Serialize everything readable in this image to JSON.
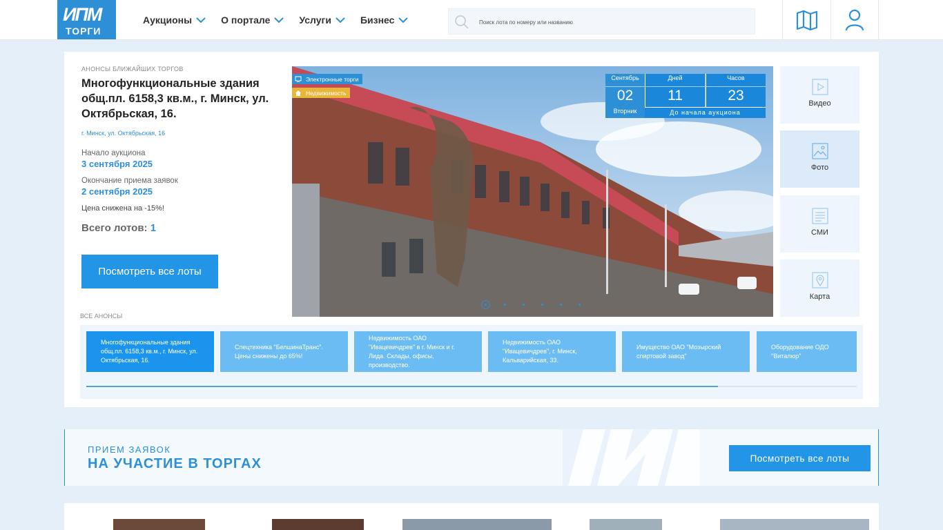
{
  "colors": {
    "accent": "#2d8fd6",
    "accent_dark": "#1a87db",
    "tag_estate": "#e8b73a",
    "page_bg": "#e4eff9"
  },
  "logo": {
    "main": "ИПМ",
    "sub": "ТОРГИ"
  },
  "nav": [
    {
      "label": "Аукционы",
      "icon": "chevron-down-icon"
    },
    {
      "label": "О портале",
      "icon": "chevron-down-icon"
    },
    {
      "label": "Услуги",
      "icon": "chevron-down-icon"
    },
    {
      "label": "Бизнес",
      "icon": "chevron-down-icon"
    }
  ],
  "search": {
    "placeholder": "Поиск лота по номеру или названию"
  },
  "header_icons": [
    "map-icon",
    "user-icon"
  ],
  "featured": {
    "kicker": "Анонсы ближайших торгов",
    "title": "Многофункциональные здания общ.пл. 6158,3 кв.м., г. Минск, ул. Октябрьская, 16.",
    "address": "г. Минск, ул. Октябрьская, 16",
    "start_label": "Начало аукциона",
    "start_date": "3 сентября 2025",
    "end_label": "Окончание приема заявок",
    "end_date": "2 сентября 2025",
    "discount": "Цена снижена на -15%!",
    "total_label": "Всего лотов:",
    "total_count": "1",
    "button": "Посмотреть все лоты"
  },
  "all_announcements_label": "Все анонсы",
  "photo": {
    "tags": [
      "Электронные торги",
      "Недвижимость"
    ],
    "countdown": {
      "month": "Сентябрь",
      "day": "02",
      "weekday": "Вторник",
      "days_label": "Дней",
      "days": "11",
      "hours_label": "Часов",
      "hours": "23",
      "until": "До начала аукциона"
    },
    "slides_count": 6,
    "active_slide": 1
  },
  "media": [
    {
      "label": "Видео",
      "icon": "video-icon"
    },
    {
      "label": "Фото",
      "icon": "photo-icon",
      "active": true
    },
    {
      "label": "СМИ",
      "icon": "document-icon"
    },
    {
      "label": "Карта",
      "icon": "map-pin-icon"
    }
  ],
  "announcements": [
    "Многофункциональные здания общ.пл. 6158,3 кв.м., г. Минск, ул. Октябрьская, 16.",
    "Спецтехника \"БелшинаТранс\". Цены снижены до 65%!",
    "Недвижимость ОАО \"Ивацевичдрев\" в г. Минск и г. Лида. Склады, офисы, производство.",
    "Недвижимость ОАО \"Ивацевичдрев\", г. Минск, Кальварийская, 33.",
    "Имущество ОАО \"Мозырский спиртовой завод\"",
    "Оборудование ОДО \"Виталюр\""
  ],
  "announcements_scroll_fraction": 0.82,
  "promo": {
    "subtitle": "Прием заявок",
    "title": "На участие в торгах",
    "button": "Посмотреть все лоты"
  }
}
